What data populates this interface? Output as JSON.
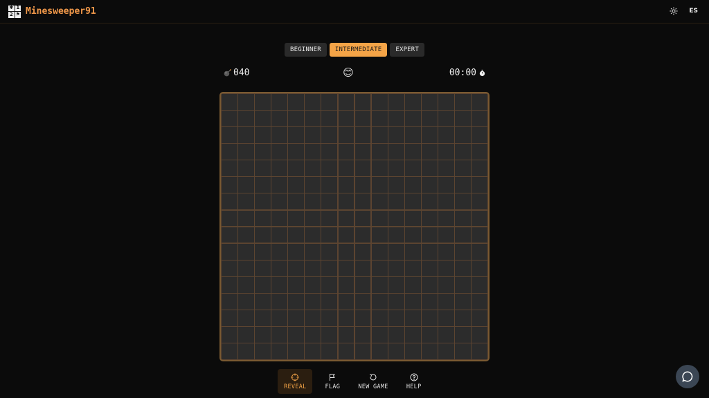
{
  "header": {
    "logo_glyphs": [
      "✱",
      "1",
      "2",
      "⚑"
    ],
    "brand": "Minesweeper91",
    "theme_icon": "sun-icon",
    "language": "ES"
  },
  "levels": [
    {
      "label": "BEGINNER",
      "active": false
    },
    {
      "label": "INTERMEDIATE",
      "active": true
    },
    {
      "label": "EXPERT",
      "active": false
    }
  ],
  "status": {
    "mine_icon": "bomb-icon",
    "mines_remaining": "040",
    "face": "😊",
    "time": "00:00",
    "timer_icon": "stopwatch-icon"
  },
  "board": {
    "rows": 16,
    "cols": 16,
    "state": "all-hidden"
  },
  "toolbar": {
    "reveal": "REVEAL",
    "flag": "FLAG",
    "new_game": "NEW GAME",
    "help": "HELP"
  },
  "colors": {
    "accent": "#f4a447",
    "brand": "#f2994a",
    "background": "#0b0b0b",
    "cell": "#2c2c2c",
    "board_border": "#7a5a32"
  },
  "chat": {
    "icon": "chat-bubble-icon"
  }
}
